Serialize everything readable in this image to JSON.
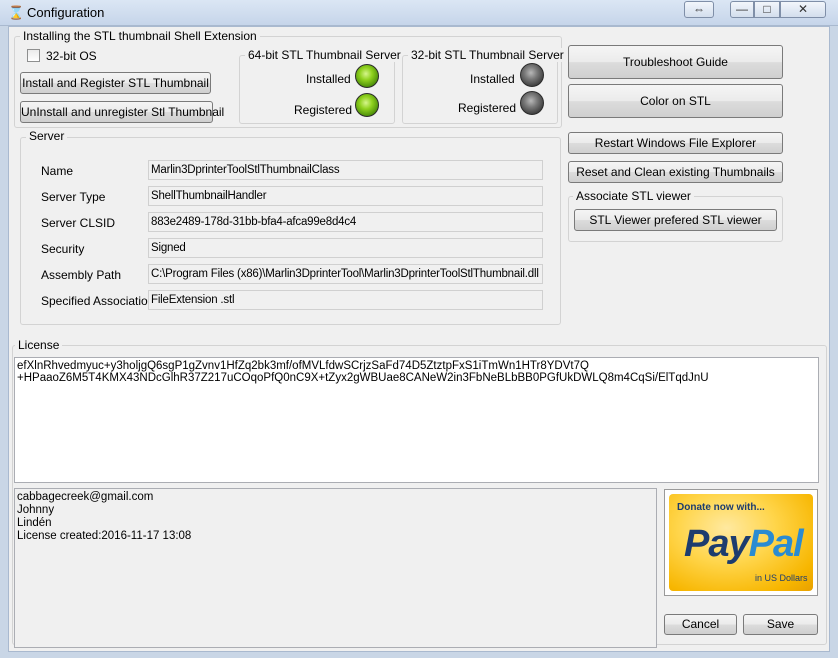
{
  "window": {
    "title": "Configuration",
    "caption_buttons": {
      "extra": "⇔",
      "minimize": "—",
      "maximize": "□",
      "close": "✕"
    }
  },
  "install_group": {
    "title": "Installing the STL thumbnail Shell Extension",
    "checkbox_32bit_label": "32-bit OS",
    "install_button": "Install  and Register STL Thumbnail",
    "uninstall_button": "UnInstall and unregister Stl Thumbnail"
  },
  "server64": {
    "title": "64-bit STL Thumbnail Server",
    "installed_label": "Installed",
    "registered_label": "Registered"
  },
  "server32": {
    "title": "32-bit STL Thumbnail Server",
    "installed_label": "Installed",
    "registered_label": "Registered"
  },
  "server_group": {
    "title": "Server",
    "rows": [
      {
        "label": "Name",
        "value": "Marlin3DprinterToolStlThumbnailClass"
      },
      {
        "label": "Server Type",
        "value": "ShellThumbnailHandler"
      },
      {
        "label": "Server CLSID",
        "value": "883e2489-178d-31bb-bfa4-afca99e8d4c4"
      },
      {
        "label": "Security",
        "value": "Signed"
      },
      {
        "label": "Assembly Path",
        "value": "C:\\Program Files (x86)\\Marlin3DprinterTool\\Marlin3DprinterToolStlThumbnail.dll"
      },
      {
        "label": "Specified Associations",
        "value": "FileExtension .stl"
      }
    ]
  },
  "right_panel": {
    "troubleshoot_button": "Troubleshoot Guide",
    "color_button": "Color on STL",
    "restart_button": "Restart Windows File Explorer",
    "reset_button": "Reset and Clean existing Thumbnails",
    "associate_group_title": "Associate STL viewer",
    "viewer_button": "STL Viewer prefered STL viewer"
  },
  "license": {
    "title": "License",
    "key_text": "efXlnRhvedmyuc+y3holjgQ6sgP1gZvnv1HfZq2bk3mf/ofMVLfdwSCrjzSaFd74D5ZtztpFxS1iTmWn1HTr8YDVt7Q\n+HPaaoZ6M5T4KMX43NDcGlhR37Z217uCOqoPfQ0nC9X+tZyx2gWBUae8CANeW2in3FbNeBLbBB0PGfUkDWLQ8m4CqSi/ElTqdJnU",
    "info_lines": [
      "cabbagecreek@gmail.com",
      "Johnny",
      "Lindén",
      "License created:2016-11-17 13:08"
    ]
  },
  "paypal": {
    "donate_text": "Donate now with...",
    "brand_pay": "Pay",
    "brand_pal": "Pal",
    "currency_text": "in US Dollars"
  },
  "footer": {
    "cancel_button": "Cancel",
    "save_button": "Save"
  },
  "colors": {
    "led_on": "#8fd11e",
    "led_off": "#5a5a5a",
    "paypal_bg": "#f7b600",
    "paypal_pay": "#1d3c6e",
    "paypal_pal": "#2a8bd1"
  }
}
